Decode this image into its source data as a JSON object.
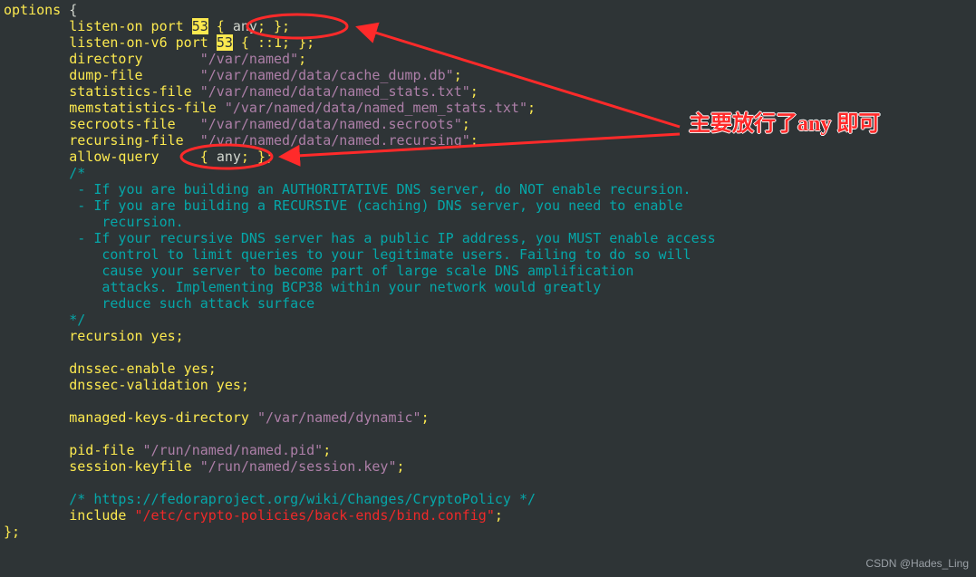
{
  "code": {
    "line01_a": "options",
    "line01_b": " {",
    "line02_a": "        listen-on port ",
    "line02_port": "53",
    "line02_b": " { ",
    "line02_c": "any",
    "line02_d": "; };",
    "line03_a": "        listen-on-v6 port ",
    "line03_port": "53",
    "line03_b": " { ::1; };",
    "line04_a": "        directory       ",
    "line04_b": "\"/var/named\"",
    "line04_c": ";",
    "line05_a": "        dump-file       ",
    "line05_b": "\"/var/named/data/cache_dump.db\"",
    "line05_c": ";",
    "line06_a": "        statistics-file ",
    "line06_b": "\"/var/named/data/named_stats.txt\"",
    "line06_c": ";",
    "line07_a": "        memstatistics-file ",
    "line07_b": "\"/var/named/data/named_mem_stats.txt\"",
    "line07_c": ";",
    "line08_a": "        secroots-file   ",
    "line08_b": "\"/var/named/data/named.secroots\"",
    "line08_c": ";",
    "line09_a": "        recursing-file  ",
    "line09_b": "\"/var/named/data/named.recursing\"",
    "line09_c": ";",
    "line10_a": "        allow-query     { ",
    "line10_b": "any",
    "line10_c": "; };",
    "cmt_open": "        /*",
    "cmt_l1": "         - If you are building an AUTHORITATIVE DNS server, do NOT enable recursion.",
    "cmt_l2": "         - If you are building a RECURSIVE (caching) DNS server, you need to enable",
    "cmt_l3": "            recursion.",
    "cmt_l4": "         - If your recursive DNS server has a public IP address, you MUST enable access",
    "cmt_l5": "            control to limit queries to your legitimate users. Failing to do so will",
    "cmt_l6": "            cause your server to become part of large scale DNS amplification",
    "cmt_l7": "            attacks. Implementing BCP38 within your network would greatly",
    "cmt_l8": "            reduce such attack surface",
    "cmt_close": "        */",
    "line20": "        recursion yes;",
    "blank": "",
    "line22": "        dnssec-enable yes;",
    "line23": "        dnssec-validation yes;",
    "line25_a": "        managed-keys-directory ",
    "line25_b": "\"/var/named/dynamic\"",
    "line25_c": ";",
    "line27_a": "        pid-file ",
    "line27_b": "\"/run/named/named.pid\"",
    "line27_c": ";",
    "line28_a": "        session-keyfile ",
    "line28_b": "\"/run/named/session.key\"",
    "line28_c": ";",
    "line30": "        /* https://fedoraproject.org/wiki/Changes/CryptoPolicy */",
    "line31_a": "        include ",
    "line31_b": "\"/etc/crypto-policies/back-ends/bind.config\"",
    "line31_c": ";",
    "line32": "};"
  },
  "annotation": {
    "text": "主要放行了any 即可"
  },
  "watermark": "CSDN @Hades_Ling",
  "colors": {
    "bg": "#2e3436",
    "keyword": "#fce94f",
    "string": "#ad7fa8",
    "comment": "#05a7a9",
    "red": "#ef2929",
    "annotation": "#ff2a2a"
  }
}
